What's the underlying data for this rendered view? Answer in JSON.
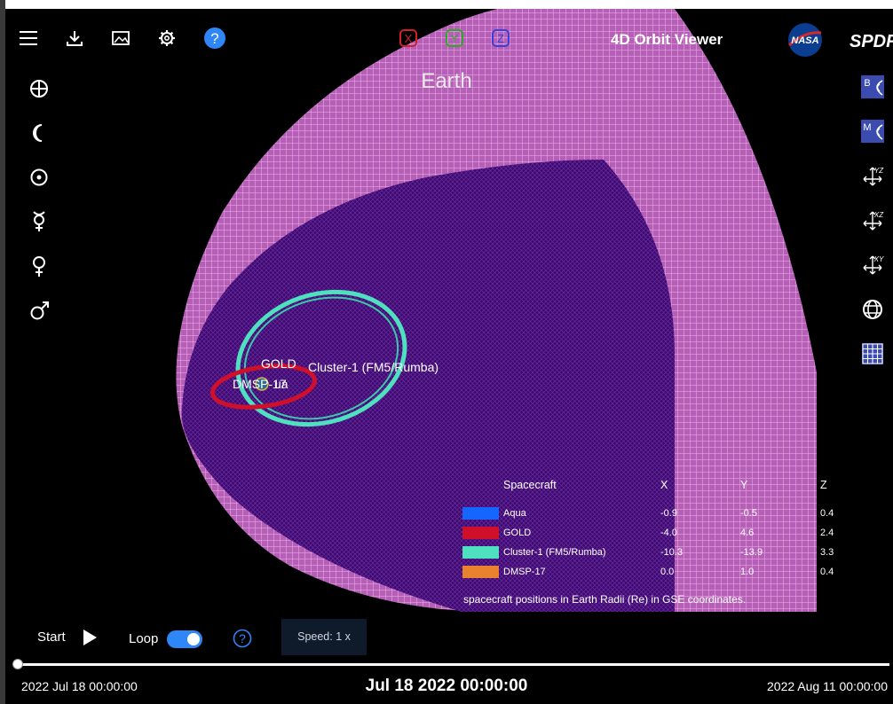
{
  "app": {
    "title": "4D Orbit Viewer",
    "logo_text": "NASA",
    "brand": "SPDF"
  },
  "toolbar": {
    "icons": [
      "menu-icon",
      "download-icon",
      "image-icon",
      "gear-icon",
      "help-icon"
    ],
    "axes": [
      "X",
      "Y",
      "Z"
    ],
    "axis_colors": [
      "#d2202b",
      "#35a52d",
      "#3b3fd8"
    ]
  },
  "scene": {
    "title": "Earth",
    "labels": {
      "gold": "GOLD",
      "cluster": "Cluster-1 (FM5/Rumba)",
      "dmsp": "DMSP-17",
      "aqua_partial": "ua"
    }
  },
  "left_bodies": [
    "earth-icon",
    "moon-icon",
    "sun-icon",
    "mercury-icon",
    "venus-icon",
    "mars-icon"
  ],
  "right_tools": [
    "bow-shock-icon",
    "magnetopause-icon",
    "yz-plane-icon",
    "xz-plane-icon",
    "xy-plane-icon",
    "globe-grid-icon",
    "grid-icon"
  ],
  "legend": {
    "headers": {
      "name": "Spacecraft",
      "x": "X",
      "y": "Y",
      "z": "Z"
    },
    "rows": [
      {
        "name": "Aqua",
        "x": "-0.9",
        "y": "-0.5",
        "z": "0.4",
        "color": "#1565ff"
      },
      {
        "name": "GOLD",
        "x": "-4.0",
        "y": "4.6",
        "z": "2.4",
        "color": "#d0102a"
      },
      {
        "name": "Cluster-1 (FM5/Rumba)",
        "x": "-10.3",
        "y": "-13.9",
        "z": "3.3",
        "color": "#4fe0c0"
      },
      {
        "name": "DMSP-17",
        "x": "0.0",
        "y": "1.0",
        "z": "0.4",
        "color": "#e8822f"
      }
    ],
    "note": "spacecraft positions in Earth Radii (Re) in GSE coordinates."
  },
  "controls": {
    "start_label": "Start",
    "loop_label": "Loop",
    "loop_on": true,
    "speed_label": "Speed: 1 x",
    "progress_fraction": 0.0
  },
  "timeline": {
    "start": "2022 Jul 18 00:00:00",
    "current": "Jul 18 2022 00:00:00",
    "end": "2022 Aug 11 00:00:00"
  }
}
